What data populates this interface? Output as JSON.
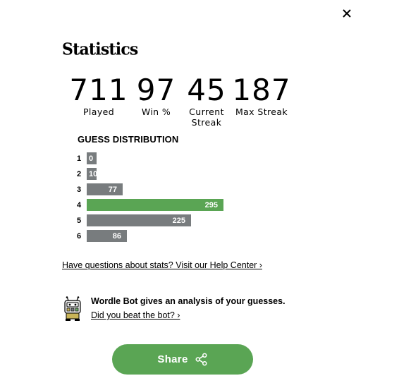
{
  "header": {
    "close_icon": "close-icon",
    "title": "Statistics"
  },
  "stats": [
    {
      "value": "711",
      "label": "Played"
    },
    {
      "value": "97",
      "label": "Win %"
    },
    {
      "value": "45",
      "label": "Current Streak"
    },
    {
      "value": "187",
      "label": "Max Streak"
    }
  ],
  "guess_distribution": {
    "heading": "GUESS DISTRIBUTION",
    "rows": [
      {
        "guess": "1",
        "count": 0
      },
      {
        "guess": "2",
        "count": 10
      },
      {
        "guess": "3",
        "count": 77
      },
      {
        "guess": "4",
        "count": 295,
        "current": true
      },
      {
        "guess": "5",
        "count": 225
      },
      {
        "guess": "6",
        "count": 86
      }
    ],
    "colors": {
      "bar": "#787c7e",
      "current_bar": "#5aa554"
    }
  },
  "help_link": "Have questions about stats? Visit our Help Center ›",
  "wordle_bot": {
    "icon": "wordle-bot-icon",
    "text": "Wordle Bot gives an analysis of your guesses.",
    "link": "Did you beat the bot? ›"
  },
  "share": {
    "label": "Share",
    "icon": "share-icon",
    "color": "#5aa554"
  }
}
